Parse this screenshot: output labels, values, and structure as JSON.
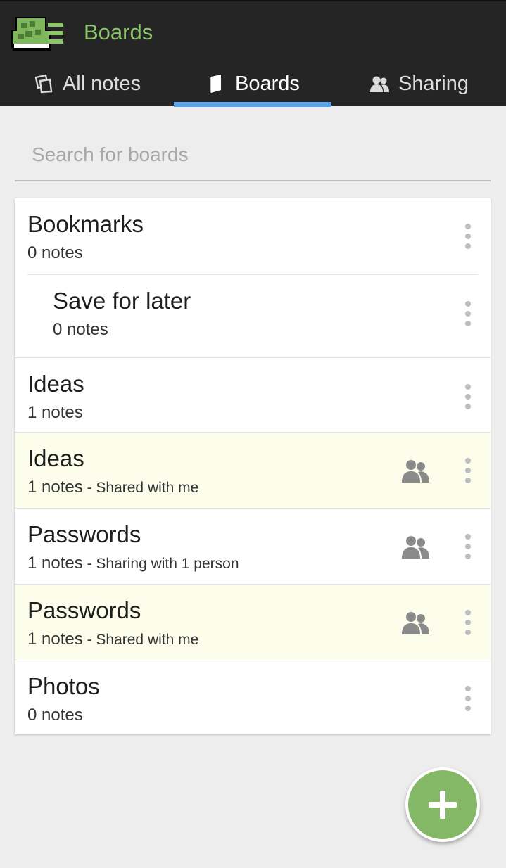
{
  "app": {
    "title": "Boards"
  },
  "tabs": [
    {
      "label": "All notes",
      "icon": "notes-icon",
      "active": false
    },
    {
      "label": "Boards",
      "icon": "board-icon",
      "active": true
    },
    {
      "label": "Sharing",
      "icon": "people-icon",
      "active": false
    }
  ],
  "search": {
    "placeholder": "Search for boards",
    "value": ""
  },
  "boards": [
    {
      "title": "Bookmarks",
      "count": "0 notes",
      "suffix": "",
      "shared": false,
      "highlight": false,
      "nested": false
    },
    {
      "title": "Save for later",
      "count": "0 notes",
      "suffix": "",
      "shared": false,
      "highlight": false,
      "nested": true
    },
    {
      "title": "Ideas",
      "count": "1 notes",
      "suffix": "",
      "shared": false,
      "highlight": false,
      "nested": false
    },
    {
      "title": "Ideas",
      "count": "1 notes",
      "suffix": " - Shared with me",
      "shared": true,
      "highlight": true,
      "nested": false
    },
    {
      "title": "Passwords",
      "count": "1 notes",
      "suffix": " - Sharing with 1 person",
      "shared": true,
      "highlight": false,
      "nested": false
    },
    {
      "title": "Passwords",
      "count": "1 notes",
      "suffix": " - Shared with me",
      "shared": true,
      "highlight": true,
      "nested": false
    },
    {
      "title": "Photos",
      "count": "0 notes",
      "suffix": "",
      "shared": false,
      "highlight": false,
      "nested": false
    }
  ],
  "fab": {
    "icon": "plus-icon"
  },
  "colors": {
    "accent": "#85b866",
    "title": "#8cc56a",
    "tab_indicator": "#5aa3e8",
    "appbar": "#252525",
    "shared_highlight": "#fcfdeb"
  }
}
